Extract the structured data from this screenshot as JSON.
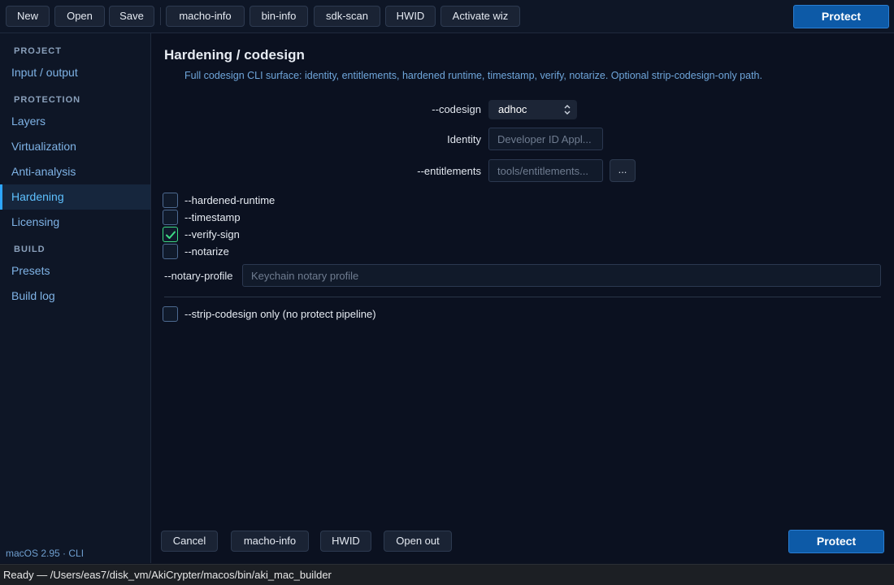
{
  "toolbar": {
    "new": "New",
    "open": "Open",
    "save": "Save",
    "macho_info": "macho-info",
    "bin_info": "bin-info",
    "sdk_scan": "sdk-scan",
    "hwid": "HWID",
    "activate_wiz": "Activate wiz",
    "protect": "Protect"
  },
  "sidebar": {
    "sections": {
      "project": "PROJECT",
      "protection": "PROTECTION",
      "build": "BUILD"
    },
    "items": {
      "input_output": "Input / output",
      "layers": "Layers",
      "virtualization": "Virtualization",
      "anti_analysis": "Anti-analysis",
      "hardening": "Hardening",
      "licensing": "Licensing",
      "presets": "Presets",
      "build_log": "Build log"
    },
    "active": "hardening",
    "footer": "macOS 2.95 · CLI"
  },
  "main": {
    "title": "Hardening / codesign",
    "subtitle": "Full codesign CLI surface: identity, entitlements, hardened runtime, timestamp, verify, notarize. Optional strip-codesign-only path.",
    "codesign": {
      "label": "--codesign",
      "value": "adhoc"
    },
    "identity": {
      "label": "Identity",
      "placeholder": "Developer ID Appl..."
    },
    "entitlements": {
      "label": "--entitlements",
      "placeholder": "tools/entitlements...",
      "browse": "..."
    },
    "checkboxes": {
      "hardened_runtime": {
        "label": "--hardened-runtime",
        "checked": false
      },
      "timestamp": {
        "label": "--timestamp",
        "checked": false
      },
      "verify_sign": {
        "label": "--verify-sign",
        "checked": true
      },
      "notarize": {
        "label": "--notarize",
        "checked": false
      },
      "strip_codesign": {
        "label": "--strip-codesign only (no protect pipeline)",
        "checked": false
      }
    },
    "notary_profile": {
      "label": "--notary-profile",
      "placeholder": "Keychain notary profile"
    }
  },
  "footer_buttons": {
    "cancel": "Cancel",
    "macho_info": "macho-info",
    "hwid": "HWID",
    "open_out": "Open out",
    "protect": "Protect"
  },
  "status": {
    "text": "Ready — /Users/eas7/disk_vm/AkiCrypter/macos/bin/aki_mac_builder"
  },
  "colors": {
    "accent": "#2ea6ff",
    "primary_button": "#0d5aa7",
    "check": "#3ddc84"
  }
}
